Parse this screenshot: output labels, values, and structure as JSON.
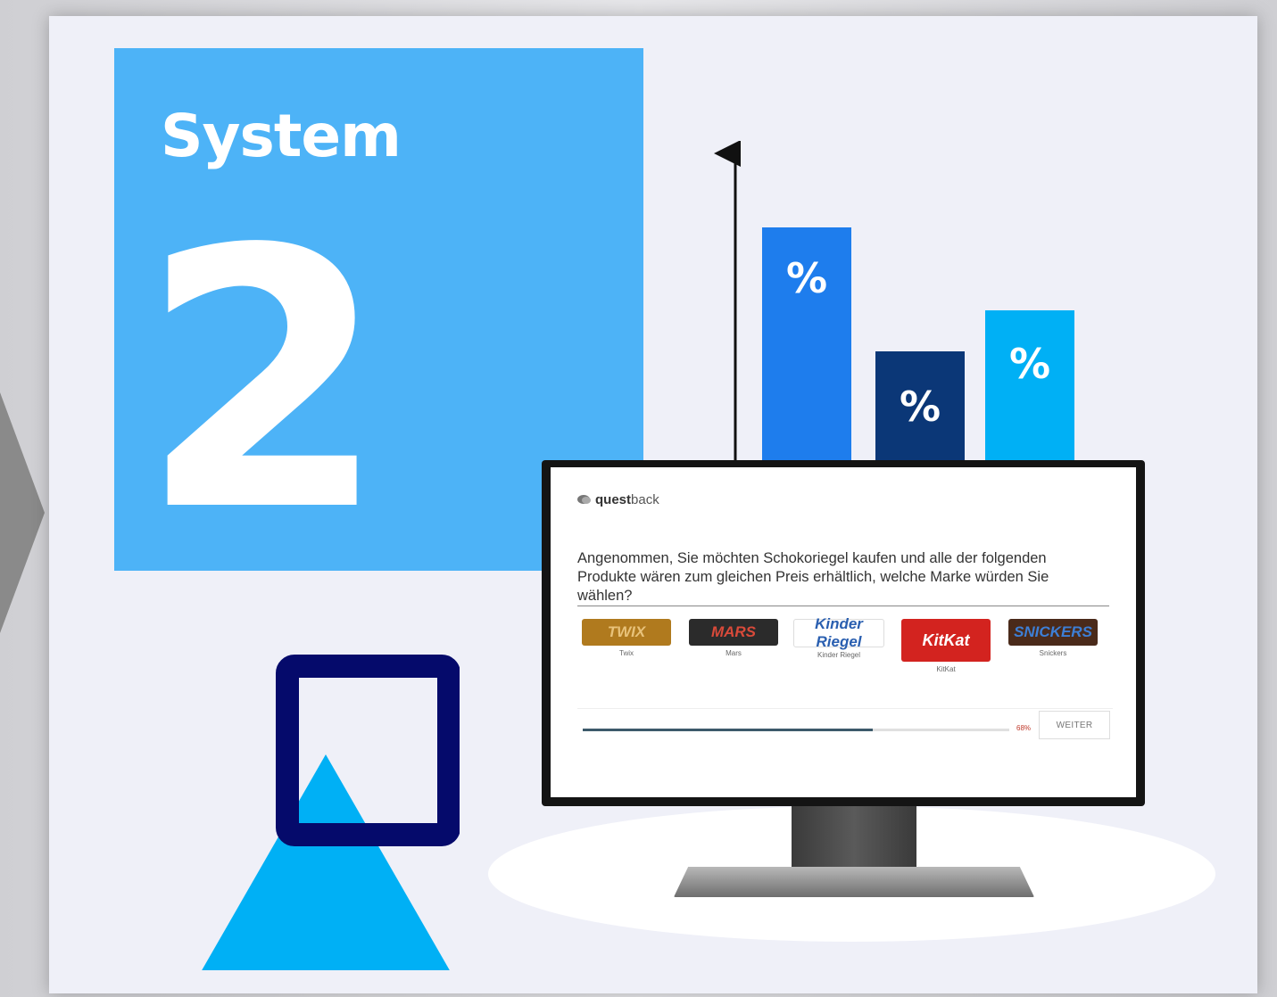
{
  "slide": {
    "title": "System",
    "number": "2",
    "colors": {
      "panel_bg": "#eff0f8",
      "title_box": "#4db3f7",
      "bar_blue": "#1e7ded",
      "bar_navy": "#0b3777",
      "bar_cyan": "#00b0f5",
      "deco_square": "#050a6b",
      "deco_triangle": "#00b0f5"
    }
  },
  "chart": {
    "bars": [
      {
        "label": "%",
        "color": "#1e7ded"
      },
      {
        "label": "%",
        "color": "#0b3777"
      },
      {
        "label": "%",
        "color": "#00b0f5"
      }
    ]
  },
  "survey": {
    "brand_bold": "quest",
    "brand_rest": "back",
    "question": "Angenommen, Sie möchten Schokoriegel kaufen und alle der folgenden Produkte wären zum gleichen Preis erhältlich, welche Marke würden Sie wählen?",
    "products": [
      {
        "name": "Twix",
        "wrapper_text": "TWIX",
        "bg": "#b07a1e",
        "fg": "#e8c27a"
      },
      {
        "name": "Mars",
        "wrapper_text": "MARS",
        "bg": "#2b2b2b",
        "fg": "#d94a3a"
      },
      {
        "name": "Kinder Riegel",
        "wrapper_text": "Kinder Riegel",
        "bg": "#ffffff",
        "fg": "#2a5fb0"
      },
      {
        "name": "KitKat",
        "wrapper_text": "KitKat",
        "bg": "#d3231f",
        "fg": "#ffffff"
      },
      {
        "name": "Snickers",
        "wrapper_text": "SNICKERS",
        "bg": "#4a2a1a",
        "fg": "#3d7fd6"
      }
    ],
    "progress": {
      "percent": 68,
      "label": "68%"
    },
    "next_label": "WEITER"
  }
}
